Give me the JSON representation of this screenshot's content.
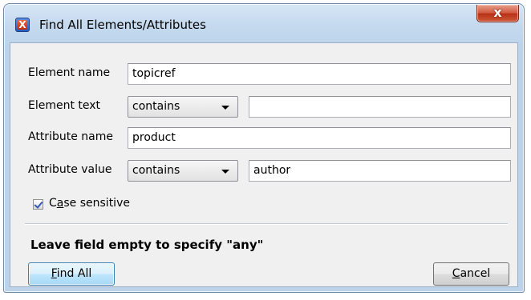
{
  "window": {
    "title": "Find All Elements/Attributes",
    "close_glyph": "x",
    "app_icon_glyph": "X"
  },
  "form": {
    "element_name": {
      "label": "Element name",
      "value": "topicref"
    },
    "element_text": {
      "label": "Element text",
      "operator": "contains",
      "value": ""
    },
    "attribute_name": {
      "label": "Attribute name",
      "value": "product"
    },
    "attribute_value": {
      "label": "Attribute value",
      "operator": "contains",
      "value": "author"
    },
    "case_sensitive": {
      "label_pre": "C",
      "label_mnemonic": "a",
      "label_post": "se sensitive",
      "checked": true
    }
  },
  "hint": "Leave field empty to specify \"any\"",
  "buttons": {
    "find_all": {
      "mnemonic": "F",
      "rest": "ind All"
    },
    "cancel": {
      "mnemonic": "C",
      "rest": "ancel"
    }
  }
}
